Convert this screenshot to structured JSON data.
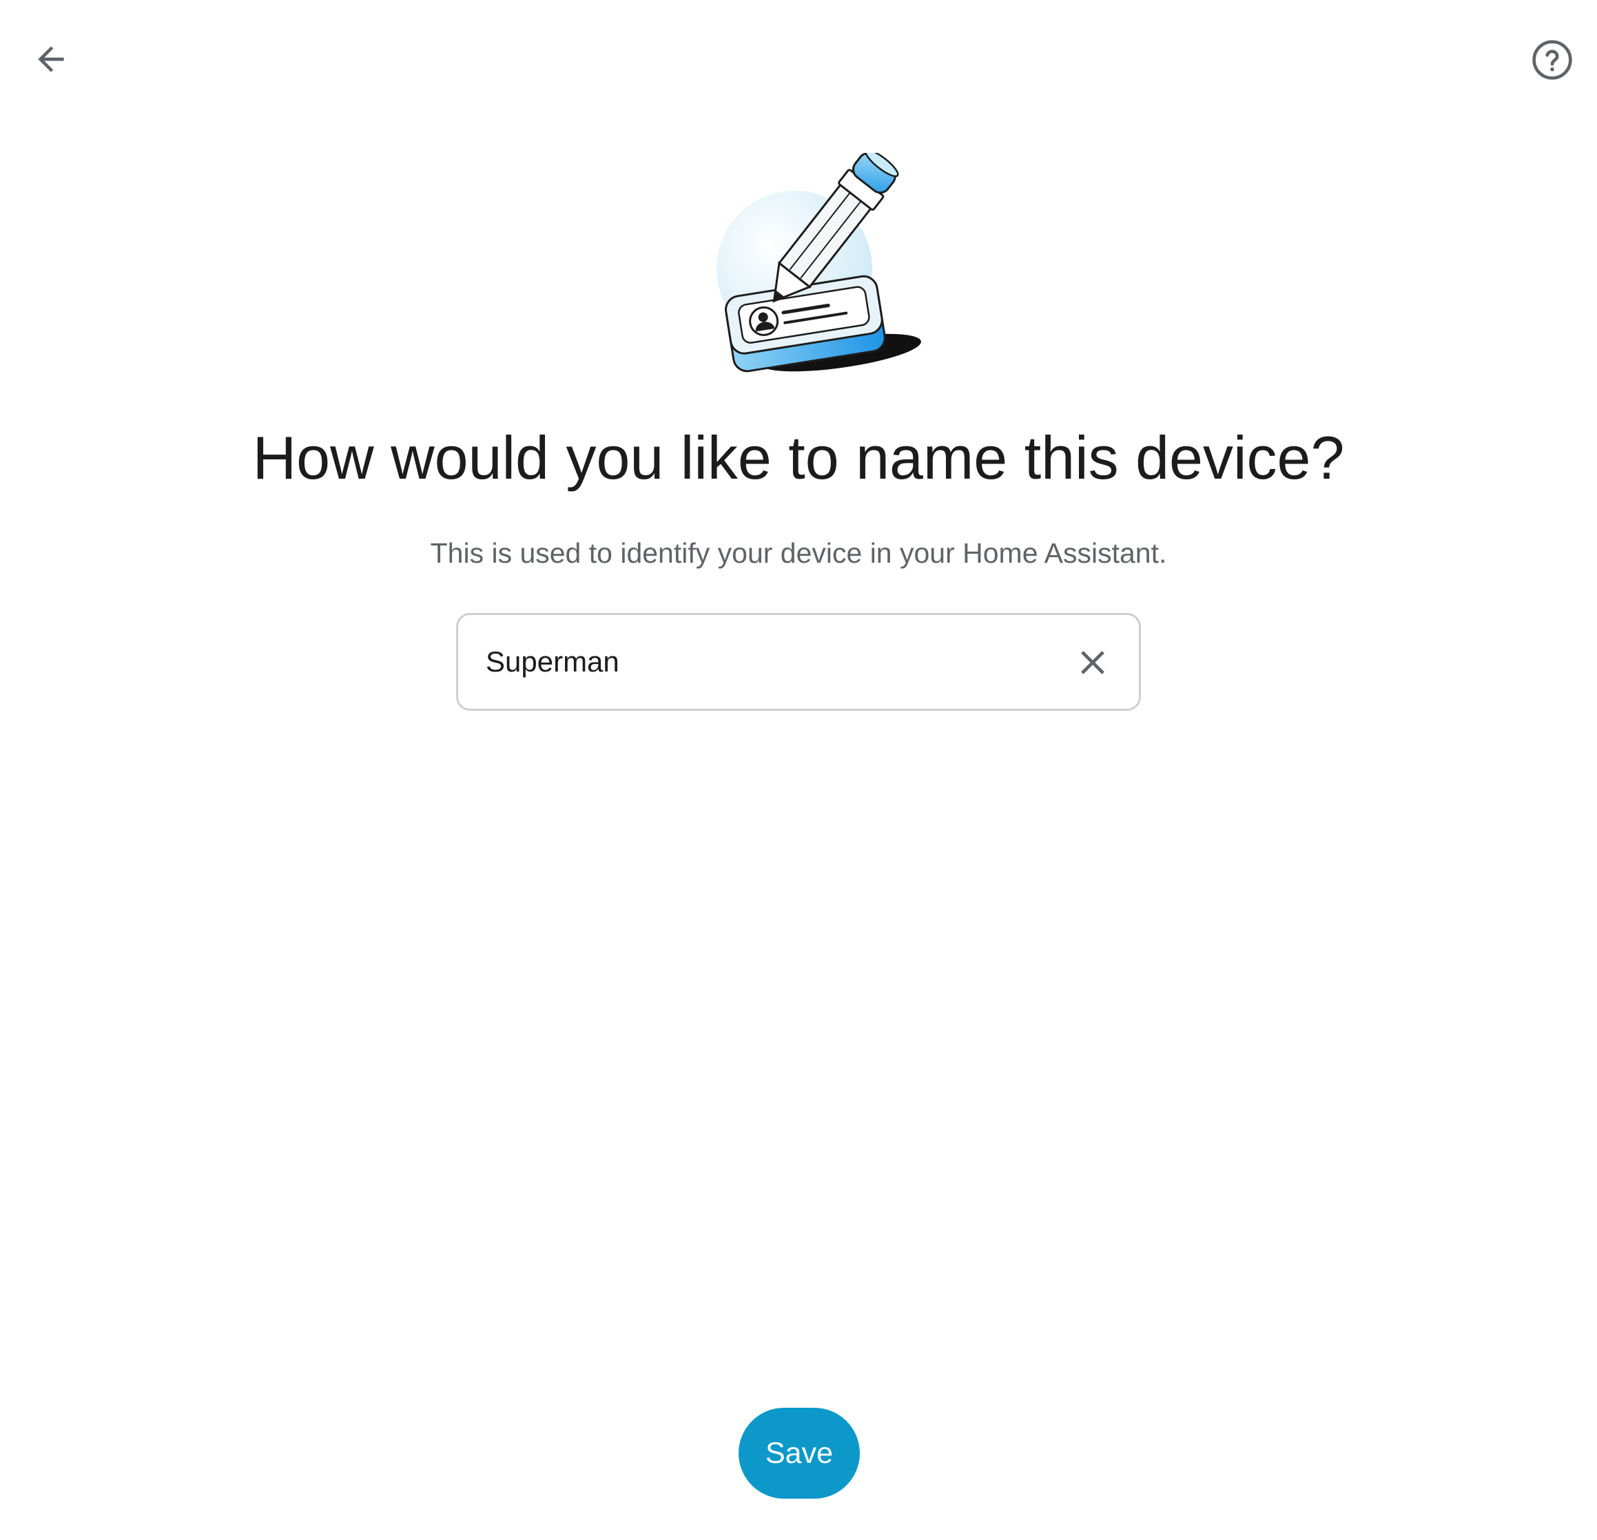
{
  "nav": {
    "back_icon": "arrow-back-icon",
    "help_icon": "help-circle-icon"
  },
  "illustration": {
    "icon": "pencil-id-card-illustration"
  },
  "main": {
    "title": "How would you like to name this device?",
    "subtitle": "This is used to identify your device in your Home Assistant.",
    "name_field": {
      "value": "Superman",
      "clear_icon": "close-icon"
    },
    "save_label": "Save"
  },
  "colors": {
    "accent": "#0c98c9",
    "title_text": "#1c1c1c",
    "subtitle_text": "#5f6368",
    "field_border": "#cfcfcf",
    "icon_gray": "#5f6368"
  }
}
